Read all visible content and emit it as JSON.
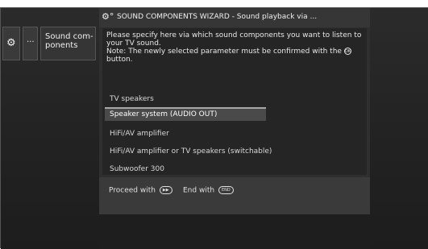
{
  "menu": {
    "gear_icon": "gear-icon",
    "dots_label": "...",
    "sound_label": "Sound com-\nponents"
  },
  "dialog": {
    "icon": "gears-icon",
    "title": "SOUND COMPONENTS WIZARD - Sound playback via ...",
    "description_line1": "Please specify here via which sound components you want to listen to your TV sound.",
    "description_line2_before": "Note: The newly selected parameter must be confirmed with the",
    "confirm_key": "OK",
    "description_line2_after": "button.",
    "options": [
      {
        "label": "TV speakers",
        "selected": false
      },
      {
        "label": "Speaker system (AUDIO OUT)",
        "selected": true
      },
      {
        "label": "HiFi/AV amplifier",
        "selected": false
      },
      {
        "label": "HiFi/AV amplifier or TV speakers (switchable)",
        "selected": false
      },
      {
        "label": "Subwoofer 300",
        "selected": false
      }
    ]
  },
  "footer": {
    "proceed_label": "Proceed with",
    "proceed_key": "▶▶",
    "end_label": "End with",
    "end_key": "END"
  },
  "colors": {
    "background": "#1c1c1c",
    "dialog": "#2f2f2f",
    "selected_row": "#4a4a4a"
  }
}
